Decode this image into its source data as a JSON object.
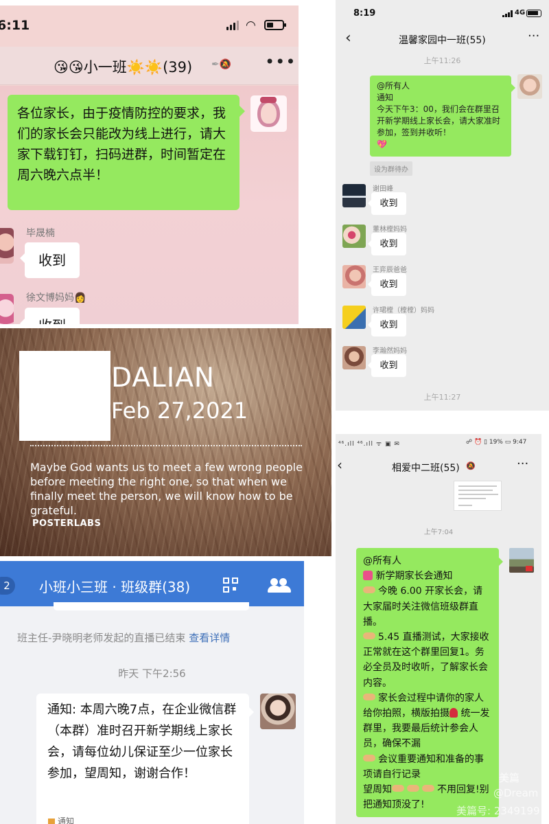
{
  "panel_a": {
    "status_time": "6:11",
    "title": "😘😘小一班☀️☀️(39)",
    "message": "各位家长，由于疫情防控的要求，我们的家长会只能改为线上进行，请大家下载钉钉，扫码进群，时间暂定在周六晚六点半！",
    "replies": [
      {
        "sender": "毕晟楠",
        "text": "收到"
      },
      {
        "sender": "徐文博妈妈👩",
        "text": "收到"
      }
    ]
  },
  "panel_b": {
    "status_time": "8:19",
    "network": "4G",
    "title": "温馨家园中一班(55)",
    "stamp_top": "上午11:26",
    "message_lines": [
      "@所有人",
      "通知",
      "今天下午3：00，我们会在群里召开新学期线上家长会，请大家准时参加，签到并收听！",
      "💖"
    ],
    "tag": "设为群待办",
    "members": [
      {
        "name": "谢田峰",
        "reply": "收到"
      },
      {
        "name": "董林樘妈妈",
        "reply": "收到"
      },
      {
        "name": "王弈辰爸爸",
        "reply": "收到"
      },
      {
        "name": "许珺樘（樘樘）妈妈",
        "reply": "收到"
      },
      {
        "name": "李瀚然妈妈",
        "reply": "收到"
      }
    ],
    "stamp_bottom": "上午11:27"
  },
  "panel_c": {
    "city": "DALIAN",
    "date": "Feb 27,2021",
    "quote": "Maybe God wants us to meet a few wrong people before meeting the right one, so that when we finally meet the person, we will know how to be grateful.",
    "brand": "POSTERLABS"
  },
  "panel_d": {
    "badge": "2",
    "title": "小班小三班 · 班级群(38)",
    "system_message": "班主任-尹晓明老师发起的直播已结束",
    "system_link": "查看详情",
    "stamp": "昨天 下午2:56",
    "message": "通知: 本周六晚7点，在企业微信群（本群）准时召开新学期线上家长会，请每位幼儿保证至少一位家长参加，望周知，谢谢合作！",
    "notice_label": "通知"
  },
  "panel_e": {
    "status_left": "⁴⁶.ıll ⁴⁶.ıll ᯤ ▣ ✉",
    "status_right": "☍ ⏰ ▯ 19% ▭ 9:47",
    "title": "相爱中二班(55)",
    "stamp": "上午7:04",
    "lines": [
      "@所有人",
      "新学期家长会通知",
      "今晚 6.00 开家长会，请大家届时关注微信班级群直播。",
      "5.45 直播测试，大家接收正常就在这个群里回复1。务必全员及时收听，了解家长会内容。",
      "家长会过程中请你的家人给你拍照，横版拍摄",
      "统一发群里，我要最后统计参会人员，确保不漏",
      "会议重要通知和准备的事项请自行记录",
      "望周知",
      "不用回复!别把通知顶没了!"
    ],
    "watermark_1": "美篇",
    "watermark_2": "@Dream",
    "watermark_3": "美篇号: 2349199"
  },
  "colors": {
    "wechat_green": "#95e95f",
    "work_blue": "#3d7ad6",
    "pink_bg": "#f3d5d3"
  }
}
